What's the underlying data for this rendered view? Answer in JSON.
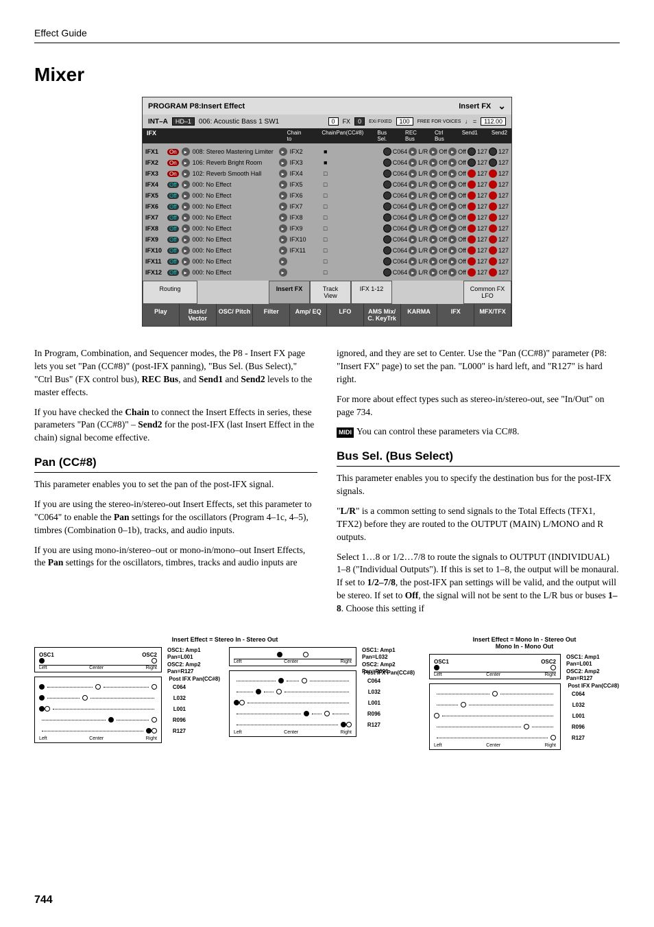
{
  "header": {
    "section": "Effect Guide"
  },
  "title": "Mixer",
  "screenshot": {
    "title": "PROGRAM P8:Insert Effect",
    "tab_title": "Insert FX",
    "bank": "INT–A",
    "patch_box": "HD–1",
    "patch_name": "006: Acoustic Bass 1 SW1",
    "fx_count_box": "0",
    "fx_label": "FX",
    "exi_box": "0",
    "exi_label": "EXi FIXED",
    "voices_box": "100",
    "voices_label": "FREE FOR VOICES",
    "tempo_icon": "♩ =",
    "tempo": "112.00",
    "section_label": "IFX",
    "col_headers": [
      "Chain to",
      "Chain",
      "Pan(CC#8)",
      "Bus Sel.",
      "REC Bus",
      "Ctrl Bus",
      "Send1",
      "Send2"
    ],
    "rows": [
      {
        "ifx": "IFX1",
        "on": true,
        "name": "008: Stereo Mastering Limiter",
        "chainto": "IFX2",
        "chain": true,
        "pan": "C064",
        "bus": "L/R",
        "rec": "Off",
        "ctrl": "Off",
        "s1": "127",
        "s2": "127",
        "gray": true
      },
      {
        "ifx": "IFX2",
        "on": true,
        "name": "106: Reverb Bright Room",
        "chainto": "IFX3",
        "chain": true,
        "pan": "C064",
        "bus": "L/R",
        "rec": "Off",
        "ctrl": "Off",
        "s1": "127",
        "s2": "127",
        "gray": true
      },
      {
        "ifx": "IFX3",
        "on": true,
        "name": "102: Reverb Smooth Hall",
        "chainto": "IFX4",
        "chain": false,
        "pan": "C064",
        "bus": "L/R",
        "rec": "Off",
        "ctrl": "Off",
        "s1": "127",
        "s2": "127",
        "gray": false
      },
      {
        "ifx": "IFX4",
        "on": false,
        "name": "000: No Effect",
        "chainto": "IFX5",
        "chain": false,
        "pan": "C064",
        "bus": "L/R",
        "rec": "Off",
        "ctrl": "Off",
        "s1": "127",
        "s2": "127",
        "gray": false
      },
      {
        "ifx": "IFX5",
        "on": false,
        "name": "000: No Effect",
        "chainto": "IFX6",
        "chain": false,
        "pan": "C064",
        "bus": "L/R",
        "rec": "Off",
        "ctrl": "Off",
        "s1": "127",
        "s2": "127",
        "gray": false
      },
      {
        "ifx": "IFX6",
        "on": false,
        "name": "000: No Effect",
        "chainto": "IFX7",
        "chain": false,
        "pan": "C064",
        "bus": "L/R",
        "rec": "Off",
        "ctrl": "Off",
        "s1": "127",
        "s2": "127",
        "gray": false
      },
      {
        "ifx": "IFX7",
        "on": false,
        "name": "000: No Effect",
        "chainto": "IFX8",
        "chain": false,
        "pan": "C064",
        "bus": "L/R",
        "rec": "Off",
        "ctrl": "Off",
        "s1": "127",
        "s2": "127",
        "gray": false
      },
      {
        "ifx": "IFX8",
        "on": false,
        "name": "000: No Effect",
        "chainto": "IFX9",
        "chain": false,
        "pan": "C064",
        "bus": "L/R",
        "rec": "Off",
        "ctrl": "Off",
        "s1": "127",
        "s2": "127",
        "gray": false
      },
      {
        "ifx": "IFX9",
        "on": false,
        "name": "000: No Effect",
        "chainto": "IFX10",
        "chain": false,
        "pan": "C064",
        "bus": "L/R",
        "rec": "Off",
        "ctrl": "Off",
        "s1": "127",
        "s2": "127",
        "gray": false
      },
      {
        "ifx": "IFX10",
        "on": false,
        "name": "000: No Effect",
        "chainto": "IFX11",
        "chain": false,
        "pan": "C064",
        "bus": "L/R",
        "rec": "Off",
        "ctrl": "Off",
        "s1": "127",
        "s2": "127",
        "gray": false
      },
      {
        "ifx": "IFX11",
        "on": false,
        "name": "000: No Effect",
        "chainto": "",
        "chain": false,
        "pan": "C064",
        "bus": "L/R",
        "rec": "Off",
        "ctrl": "Off",
        "s1": "127",
        "s2": "127",
        "gray": false
      },
      {
        "ifx": "IFX12",
        "on": false,
        "name": "000: No Effect",
        "chainto": "",
        "chain": false,
        "pan": "C064",
        "bus": "L/R",
        "rec": "Off",
        "ctrl": "Off",
        "s1": "127",
        "s2": "127",
        "gray": false
      }
    ],
    "mid_tabs": [
      "Routing",
      "Insert FX",
      "Track View",
      "IFX 1-12",
      "Common FX LFO"
    ],
    "bottom_tabs": [
      "Play",
      "Basic/ Vector",
      "OSC/ Pitch",
      "Filter",
      "Amp/ EQ",
      "LFO",
      "AMS Mix/ C. KeyTrk",
      "KARMA",
      "IFX",
      "MFX/TFX"
    ]
  },
  "body": {
    "p1": "In Program, Combination, and Sequencer modes, the P8 - Insert FX page lets you set \"Pan (CC#8)\" (post-IFX panning), \"Bus Sel. (Bus Select),\" \"Ctrl Bus\" (FX control bus), REC Bus, and Send1 and Send2 levels to the master effects.",
    "p2": "If you have checked the Chain to connect the Insert Effects in series, these parameters \"Pan (CC#8)\" – Send2 for the post-IFX (last Insert Effect in the chain) signal become effective.",
    "h_pan": "Pan (CC#8)",
    "p3": "This parameter enables you to set the pan of the post-IFX signal.",
    "p4": "If you are using the stereo-in/stereo-out Insert Effects, set this parameter to \"C064\" to enable the Pan settings for the oscillators (Program 4–1c, 4–5), timbres (Combination 0–1b), tracks, and audio inputs.",
    "p5": "If you are using mono-in/stereo–out or mono-in/mono–out Insert Effects, the Pan settings for the oscillators, timbres, tracks and audio inputs are",
    "p6": "ignored, and they are set to Center. Use the \"Pan (CC#8)\" parameter (P8: \"Insert FX\" page) to set the pan. \"L000\" is hard left, and \"R127\" is hard right.",
    "p7": "For more about effect types such as stereo-in/stereo-out, see \"In/Out\" on page 734.",
    "midi_label": "MIDI",
    "p8": "You can control these parameters via CC#8.",
    "h_bus": "Bus Sel. (Bus Select)",
    "p9": "This parameter enables you to specify the destination bus for the post-IFX signals.",
    "p10": "\"L/R\" is a common setting to send signals to the Total Effects (TFX1, TFX2) before they are routed to the OUTPUT (MAIN) L/MONO and R outputs.",
    "p11": "Select 1…8 or 1/2…7/8 to route the signals to OUTPUT (INDIVIDUAL) 1–8 (\"Individual Outputs\"). If this is set to 1–8, the output will be monaural. If set to 1/2–7/8, the post-IFX pan settings will be valid, and the output will be stereo. If set to Off, the signal will not be sent to the L/R bus or buses 1–8. Choose this setting if"
  },
  "diagrams": {
    "left_title": "Insert Effect = Stereo In - Stereo Out",
    "right_title": "Insert Effect = Mono In - Stereo Out\nMono In - Mono Out",
    "osc1": "OSC1",
    "osc2": "OSC2",
    "left": "Left",
    "center": "Center",
    "right": "Right",
    "cap1": "OSC1: Amp1 Pan=L001\nOSC2: Amp2 Pan=R127",
    "cap2": "OSC1: Amp1 Pan=L032\nOSC2: Amp2 Pan=R096",
    "post_head": "Post IFX Pan(CC#8)",
    "post_labels": [
      "C064",
      "L032",
      "L001",
      "R096",
      "R127"
    ]
  },
  "page_number": "744"
}
